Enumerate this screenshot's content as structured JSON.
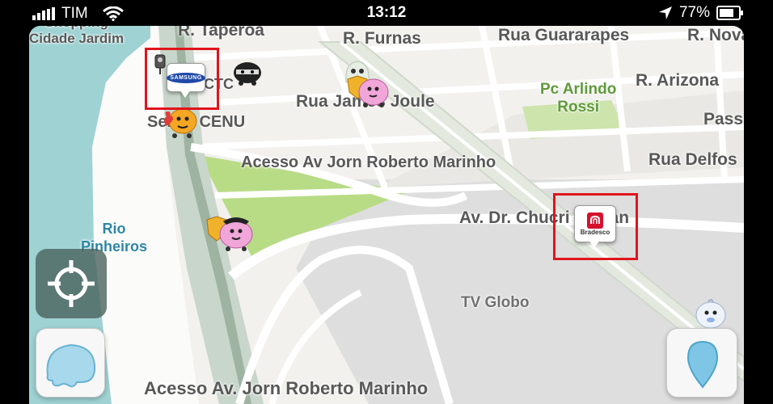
{
  "status_bar": {
    "carrier": "TIM",
    "time": "13:12",
    "battery": "77%",
    "icons": [
      "signal-bars-icon",
      "wifi-icon",
      "location-arrow-icon",
      "battery-icon"
    ]
  },
  "map": {
    "street_labels": {
      "shopping_cidade_jardim": "Shopping\nCidade Jardim",
      "r_taperoa": "R. Taperoá",
      "r_furnas": "R. Furnas",
      "rua_guararapes": "Rua Guararapes",
      "r_nova": "R. Nova",
      "r_arizona": "R. Arizona",
      "pc_arlindo_rossi": "Pc Arlindo\nRossi",
      "rua_james_joule": "Rua James Joule",
      "ctc": "CTC",
      "senac_cenu": "Senac CENU",
      "pass": "Pass",
      "acesso_av_jorn_1": "Acesso Av Jorn Roberto Marinho",
      "rua_delfos": "Rua Delfos",
      "av_dr_chucri_zaidan": "Av. Dr. Chucri Zaidan",
      "rio_pinheiros": "Rio\nPinheiros",
      "tv_globo": "TV Globo",
      "acesso_av_jorn_2": "Acesso Av. Jorn Roberto Marinho"
    },
    "ads": {
      "samsung": "SAMSUNG",
      "bradesco": "Bradesco"
    },
    "colors": {
      "river": "#9fd2d3",
      "park": "#b8dc86",
      "highway": "#c9d6cb",
      "highlight": "#e1141c"
    }
  },
  "controls": {
    "recenter": "crosshair-icon",
    "menu": "waze-menu-icon",
    "report": "report-pin-icon"
  }
}
